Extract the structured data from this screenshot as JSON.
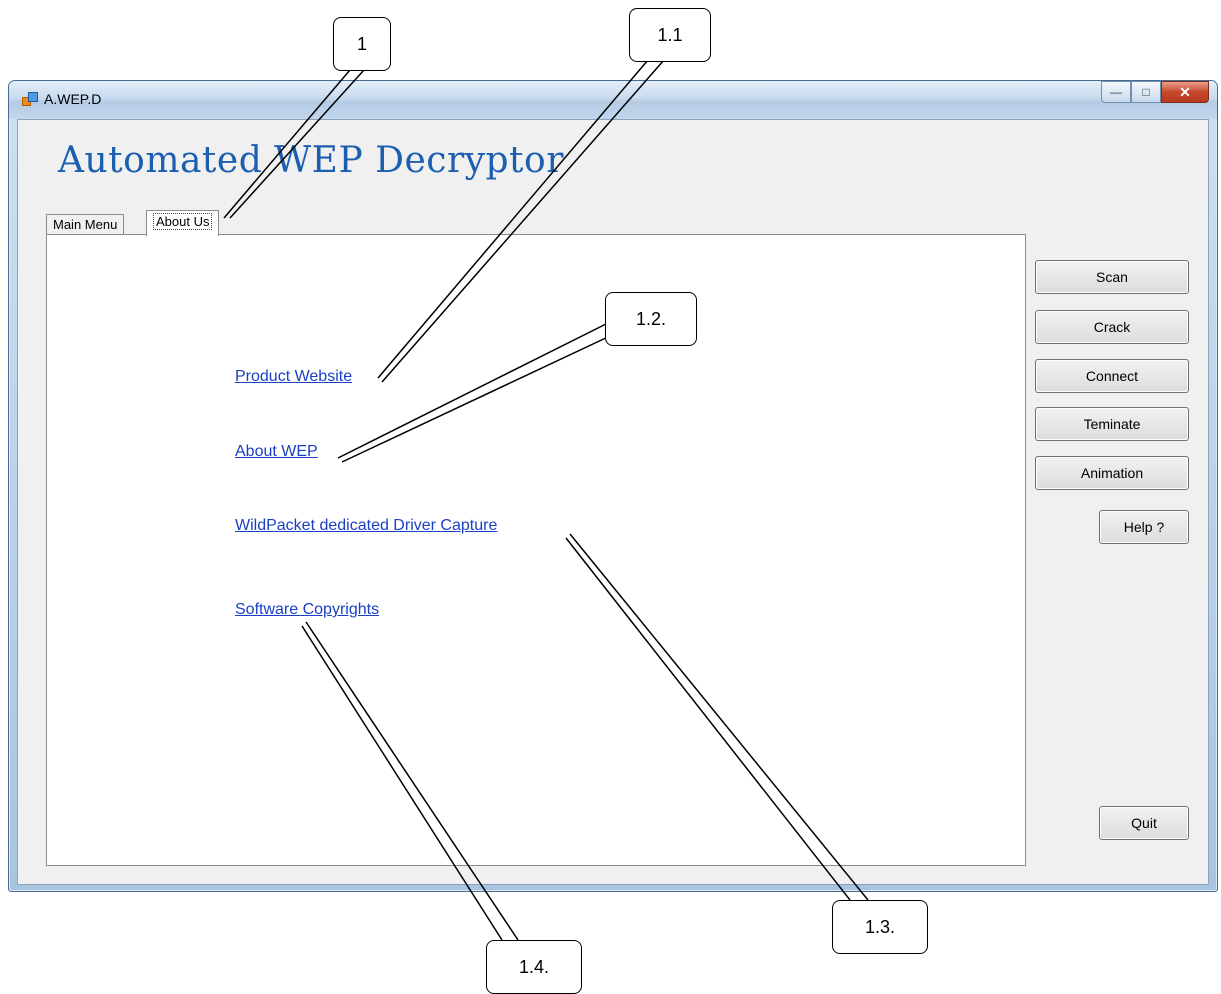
{
  "window": {
    "title": "A.WEP.D"
  },
  "app": {
    "heading": "Automated WEP Decryptor"
  },
  "tabs": [
    {
      "label": "Main Menu",
      "active": false
    },
    {
      "label": "About Us",
      "active": true
    }
  ],
  "links": {
    "product_website": "Product Website",
    "about_wep": "About WEP",
    "driver_capture": "WildPacket dedicated Driver Capture",
    "copyrights": "Software Copyrights"
  },
  "buttons": {
    "scan": "Scan",
    "crack": "Crack",
    "connect": "Connect",
    "terminate": "Teminate",
    "animation": "Animation",
    "help": "Help ?",
    "quit": "Quit"
  },
  "callouts": {
    "c1": "1",
    "c11": "1.1",
    "c12": "1.2.",
    "c13": "1.3.",
    "c14": "1.4."
  },
  "icons": {
    "app": "app-icon",
    "minimize": "minimize-icon",
    "maximize": "maximize-icon",
    "close": "close-icon"
  },
  "colors": {
    "heading": "#1c5fb0",
    "link": "#1a3fc4"
  }
}
